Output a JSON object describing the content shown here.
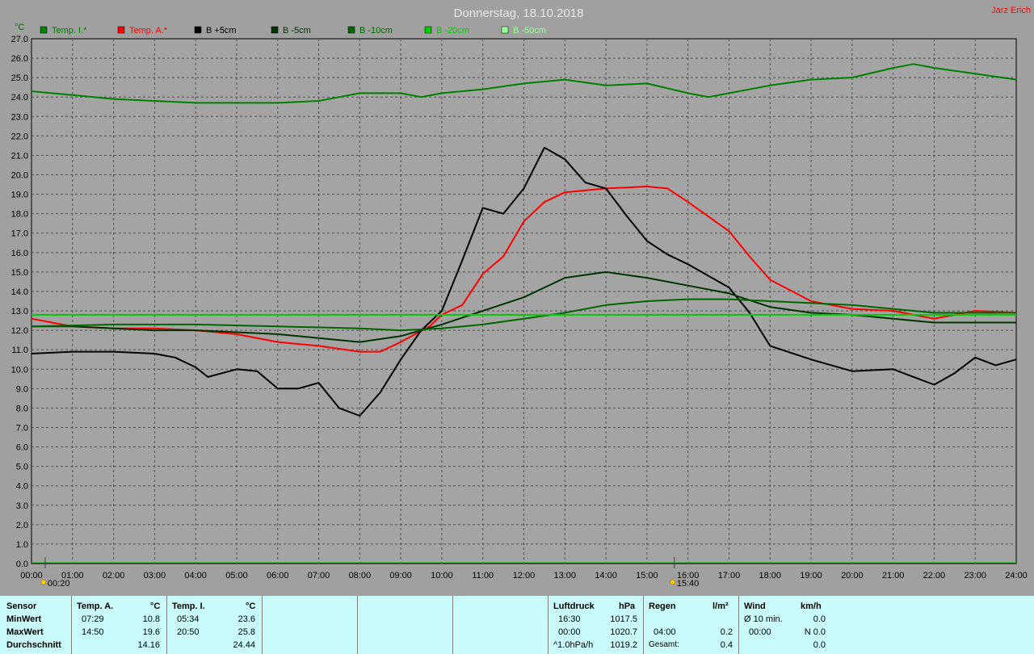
{
  "header": {
    "title": "Donnerstag, 18.10.2018",
    "author": "Jarz Erich"
  },
  "chart_data": {
    "type": "line",
    "ylabel": "°C",
    "ylim": [
      0,
      27
    ],
    "yticks": [
      "0.0",
      "1.0",
      "2.0",
      "3.0",
      "4.0",
      "5.0",
      "6.0",
      "7.0",
      "8.0",
      "9.0",
      "10.0",
      "11.0",
      "12.0",
      "13.0",
      "14.0",
      "15.0",
      "16.0",
      "17.0",
      "18.0",
      "19.0",
      "20.0",
      "21.0",
      "22.0",
      "23.0",
      "24.0",
      "25.0",
      "26.0",
      "27.0"
    ],
    "xlim": [
      0,
      24
    ],
    "xticks": [
      "00:00",
      "01:00",
      "02:00",
      "03:00",
      "04:00",
      "05:00",
      "06:00",
      "07:00",
      "08:00",
      "09:00",
      "10:00",
      "11:00",
      "12:00",
      "13:00",
      "14:00",
      "15:00",
      "16:00",
      "17:00",
      "18:00",
      "19:00",
      "20:00",
      "21:00",
      "22:00",
      "23:00",
      "24:00"
    ],
    "grid": true,
    "legend_position": "top",
    "markers": [
      {
        "label": "00:20",
        "x": 0.333,
        "icon": "sunrise-icon"
      },
      {
        "label": "15:40",
        "x": 15.667,
        "icon": "sunset-icon"
      }
    ],
    "series": [
      {
        "name": "Temp. I.*",
        "color": "#008000",
        "points": [
          [
            0,
            24.3
          ],
          [
            1,
            24.1
          ],
          [
            2,
            23.9
          ],
          [
            3,
            23.8
          ],
          [
            4,
            23.7
          ],
          [
            5,
            23.7
          ],
          [
            6,
            23.7
          ],
          [
            7,
            23.8
          ],
          [
            7.5,
            24.0
          ],
          [
            8,
            24.2
          ],
          [
            9,
            24.2
          ],
          [
            9.5,
            24.0
          ],
          [
            10,
            24.2
          ],
          [
            11,
            24.4
          ],
          [
            12,
            24.7
          ],
          [
            13,
            24.9
          ],
          [
            14,
            24.6
          ],
          [
            15,
            24.7
          ],
          [
            16,
            24.2
          ],
          [
            16.5,
            24.0
          ],
          [
            17,
            24.2
          ],
          [
            18,
            24.6
          ],
          [
            19,
            24.9
          ],
          [
            20,
            25.0
          ],
          [
            21,
            25.5
          ],
          [
            21.5,
            25.7
          ],
          [
            22,
            25.5
          ],
          [
            23,
            25.2
          ],
          [
            24,
            24.9
          ]
        ]
      },
      {
        "name": "Temp. A.*",
        "color": "#ff0000",
        "points": [
          [
            0,
            12.6
          ],
          [
            0.5,
            12.4
          ],
          [
            1,
            12.2
          ],
          [
            2,
            12.1
          ],
          [
            3,
            12.1
          ],
          [
            4,
            12.0
          ],
          [
            5,
            11.8
          ],
          [
            6,
            11.4
          ],
          [
            7,
            11.2
          ],
          [
            8,
            10.9
          ],
          [
            8.5,
            10.9
          ],
          [
            9,
            11.4
          ],
          [
            9.7,
            12.2
          ],
          [
            10,
            12.8
          ],
          [
            10.5,
            13.3
          ],
          [
            11,
            14.9
          ],
          [
            11.5,
            15.8
          ],
          [
            12,
            17.6
          ],
          [
            12.5,
            18.6
          ],
          [
            13,
            19.1
          ],
          [
            14,
            19.3
          ],
          [
            15,
            19.4
          ],
          [
            15.5,
            19.3
          ],
          [
            16,
            18.6
          ],
          [
            17,
            17.1
          ],
          [
            17.5,
            15.8
          ],
          [
            18,
            14.6
          ],
          [
            19,
            13.5
          ],
          [
            20,
            13.1
          ],
          [
            21,
            13.0
          ],
          [
            21.5,
            12.8
          ],
          [
            22,
            12.6
          ],
          [
            22.5,
            12.8
          ],
          [
            23,
            13.0
          ],
          [
            24,
            12.9
          ]
        ]
      },
      {
        "name": "B +5cm",
        "color": "#000000",
        "points": [
          [
            0,
            10.8
          ],
          [
            1,
            10.9
          ],
          [
            2,
            10.9
          ],
          [
            3,
            10.8
          ],
          [
            3.5,
            10.6
          ],
          [
            4,
            10.1
          ],
          [
            4.3,
            9.6
          ],
          [
            5,
            10.0
          ],
          [
            5.5,
            9.9
          ],
          [
            6,
            9.0
          ],
          [
            6.5,
            9.0
          ],
          [
            7,
            9.3
          ],
          [
            7.5,
            8.0
          ],
          [
            8,
            7.6
          ],
          [
            8.5,
            8.8
          ],
          [
            9,
            10.5
          ],
          [
            9.5,
            12.0
          ],
          [
            10,
            13.0
          ],
          [
            10.5,
            15.6
          ],
          [
            11,
            18.3
          ],
          [
            11.5,
            18.0
          ],
          [
            12,
            19.3
          ],
          [
            12.5,
            21.4
          ],
          [
            13,
            20.8
          ],
          [
            13.5,
            19.6
          ],
          [
            14,
            19.3
          ],
          [
            14.5,
            17.9
          ],
          [
            15,
            16.6
          ],
          [
            15.5,
            15.9
          ],
          [
            16,
            15.4
          ],
          [
            16.5,
            14.8
          ],
          [
            17,
            14.2
          ],
          [
            17.5,
            12.9
          ],
          [
            18,
            11.2
          ],
          [
            19,
            10.5
          ],
          [
            20,
            9.9
          ],
          [
            21,
            10.0
          ],
          [
            21.5,
            9.6
          ],
          [
            22,
            9.2
          ],
          [
            22.5,
            9.8
          ],
          [
            23,
            10.6
          ],
          [
            23.5,
            10.2
          ],
          [
            24,
            10.5
          ]
        ]
      },
      {
        "name": "B -5cm",
        "color": "#003300",
        "points": [
          [
            0,
            12.2
          ],
          [
            1,
            12.2
          ],
          [
            2,
            12.1
          ],
          [
            3,
            12.0
          ],
          [
            4,
            12.0
          ],
          [
            5,
            11.9
          ],
          [
            6,
            11.8
          ],
          [
            7,
            11.6
          ],
          [
            8,
            11.4
          ],
          [
            9,
            11.7
          ],
          [
            10,
            12.3
          ],
          [
            11,
            13.0
          ],
          [
            12,
            13.7
          ],
          [
            13,
            14.7
          ],
          [
            14,
            15.0
          ],
          [
            15,
            14.7
          ],
          [
            16,
            14.3
          ],
          [
            17,
            13.9
          ],
          [
            18,
            13.2
          ],
          [
            19,
            12.9
          ],
          [
            20,
            12.8
          ],
          [
            21,
            12.6
          ],
          [
            22,
            12.4
          ],
          [
            24,
            12.4
          ]
        ]
      },
      {
        "name": "B -10cm",
        "color": "#006600",
        "points": [
          [
            0,
            12.2
          ],
          [
            2,
            12.3
          ],
          [
            4,
            12.3
          ],
          [
            6,
            12.2
          ],
          [
            8,
            12.1
          ],
          [
            9,
            12.0
          ],
          [
            10,
            12.1
          ],
          [
            11,
            12.3
          ],
          [
            12,
            12.6
          ],
          [
            13,
            12.9
          ],
          [
            14,
            13.3
          ],
          [
            15,
            13.5
          ],
          [
            16,
            13.6
          ],
          [
            17,
            13.6
          ],
          [
            18,
            13.5
          ],
          [
            19,
            13.4
          ],
          [
            20,
            13.3
          ],
          [
            21,
            13.1
          ],
          [
            22,
            12.9
          ],
          [
            24,
            12.9
          ]
        ]
      },
      {
        "name": "B -20cm",
        "color": "#00cc00",
        "points": [
          [
            0,
            12.8
          ],
          [
            24,
            12.8
          ]
        ]
      },
      {
        "name": "B -50cm",
        "color": "#99ff99",
        "points": []
      }
    ]
  },
  "stats": {
    "sensor": {
      "label": "Sensor",
      "min": "MinWert",
      "max": "MaxWert",
      "avg": "Durchschnitt"
    },
    "temp_a": {
      "label": "Temp. A.",
      "unit": "°C",
      "min_time": "07:29",
      "min_value": "10.8",
      "max_time": "14:50",
      "max_value": "19.6",
      "avg_value": "14.16"
    },
    "temp_i": {
      "label": "Temp. I.",
      "unit": "°C",
      "min_time": "05:34",
      "min_value": "23.6",
      "max_time": "20:50",
      "max_value": "25.8",
      "avg_value": "24.44"
    },
    "luftdruck": {
      "label": "Luftdruck",
      "unit": "hPa",
      "min_time": "16:30",
      "min_value": "1017.5",
      "max_time": "00:00",
      "max_value": "1020.7",
      "trend_label": "^1.0hPa/h",
      "trend_value": "1019.2"
    },
    "regen": {
      "label": "Regen",
      "unit": "l/m²",
      "max_time": "04:00",
      "max_value": "0.2",
      "total_label": "Gesamt:",
      "total_value": "0.4"
    },
    "wind": {
      "label": "Wind",
      "unit": "km/h",
      "avg_label": "Ø 10 min.",
      "avg_value": "0.0",
      "max_time": "00:00",
      "max_dir_value": "N 0.0",
      "third_value": "0.0"
    }
  }
}
